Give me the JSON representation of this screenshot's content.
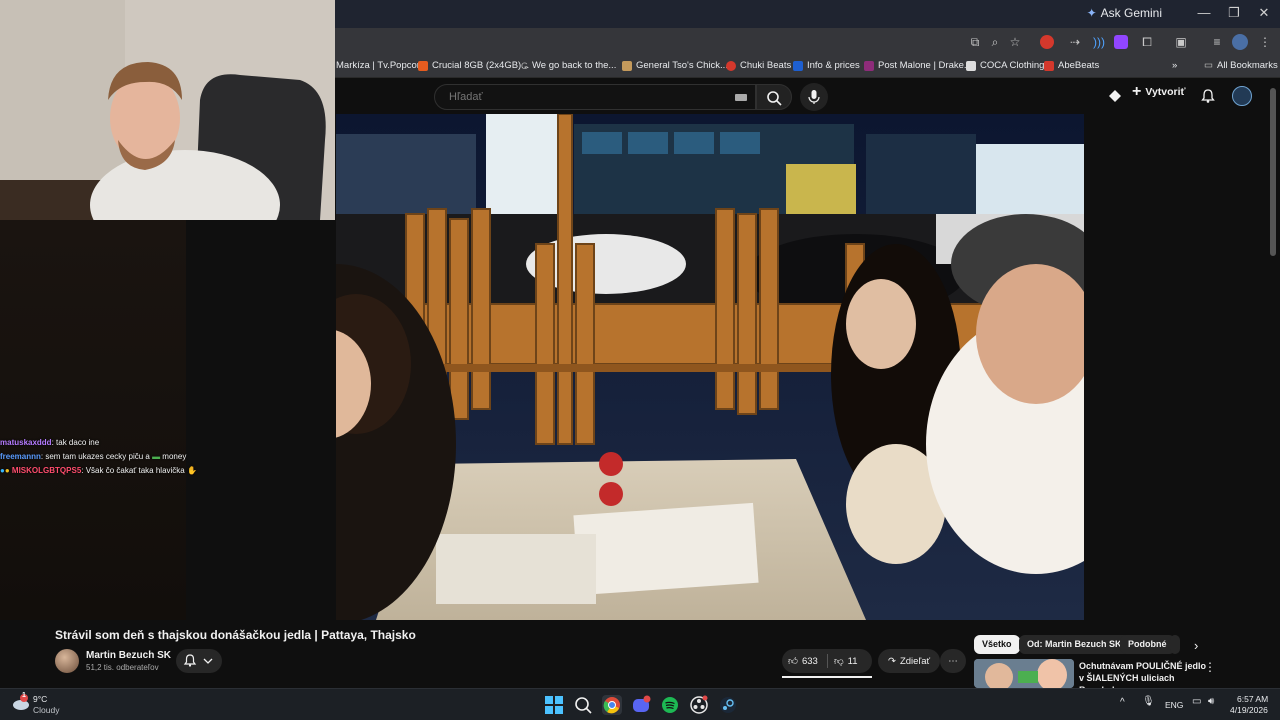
{
  "browser": {
    "ask_gemini": "Ask Gemini",
    "bookmarks": [
      {
        "label": "Markíza | Tv.Popcor...",
        "color": "#3a7bd5"
      },
      {
        "label": "Crucial 8GB (2x4GB)...",
        "color": "#e65c1f"
      },
      {
        "label": "We go back to the...",
        "color": "#2b2b2b"
      },
      {
        "label": "General Tso's Chick...",
        "color": "#c49a5c"
      },
      {
        "label": "Chuki Beats",
        "color": "#d4382c"
      },
      {
        "label": "Info & prices",
        "color": "#1d5fd1"
      },
      {
        "label": "Post Malone | Drake...",
        "color": "#8e2c7a"
      },
      {
        "label": "COCA Clothing",
        "color": "#dddddd"
      },
      {
        "label": "AbeBeats",
        "color": "#d4382c"
      }
    ],
    "all_bookmarks": "All Bookmarks"
  },
  "youtube": {
    "search_placeholder": "Hľadať",
    "create_label": "Vytvoriť",
    "video_title": "Strávil som deň s thajskou donášačkou jedla | Pattaya, Thajsko",
    "channel_name": "Martin Bezuch SK",
    "subscribers": "51,2 tis. odberateľov",
    "likes": "633",
    "dislikes": "11",
    "share_label": "Zdieľať",
    "chips": [
      "Všetko",
      "Od: Martin Bezuch SK",
      "Podobné"
    ],
    "rec_title": "Ochutnávam POULIČNÉ jedlo v ŠIALENÝCH uliciach Bangkok..."
  },
  "chat": [
    {
      "user": "matuskaxddd",
      "user_color": "#b57bff",
      "text": ": tak daco ine"
    },
    {
      "user": "freemannn",
      "user_color": "#5b9cff",
      "text": ": sem tam ukazes cecky piču a",
      "suffix": " money"
    },
    {
      "user": "MISKOLGBTQPS5",
      "user_color": "#ff4d6d",
      "text": ": Však čo čakať taka hlavička"
    }
  ],
  "taskbar": {
    "temperature": "9°C",
    "weather": "Cloudy",
    "language": "ENG",
    "time": "6:57 AM",
    "date": "4/19/2026",
    "weather_badge": "1"
  }
}
